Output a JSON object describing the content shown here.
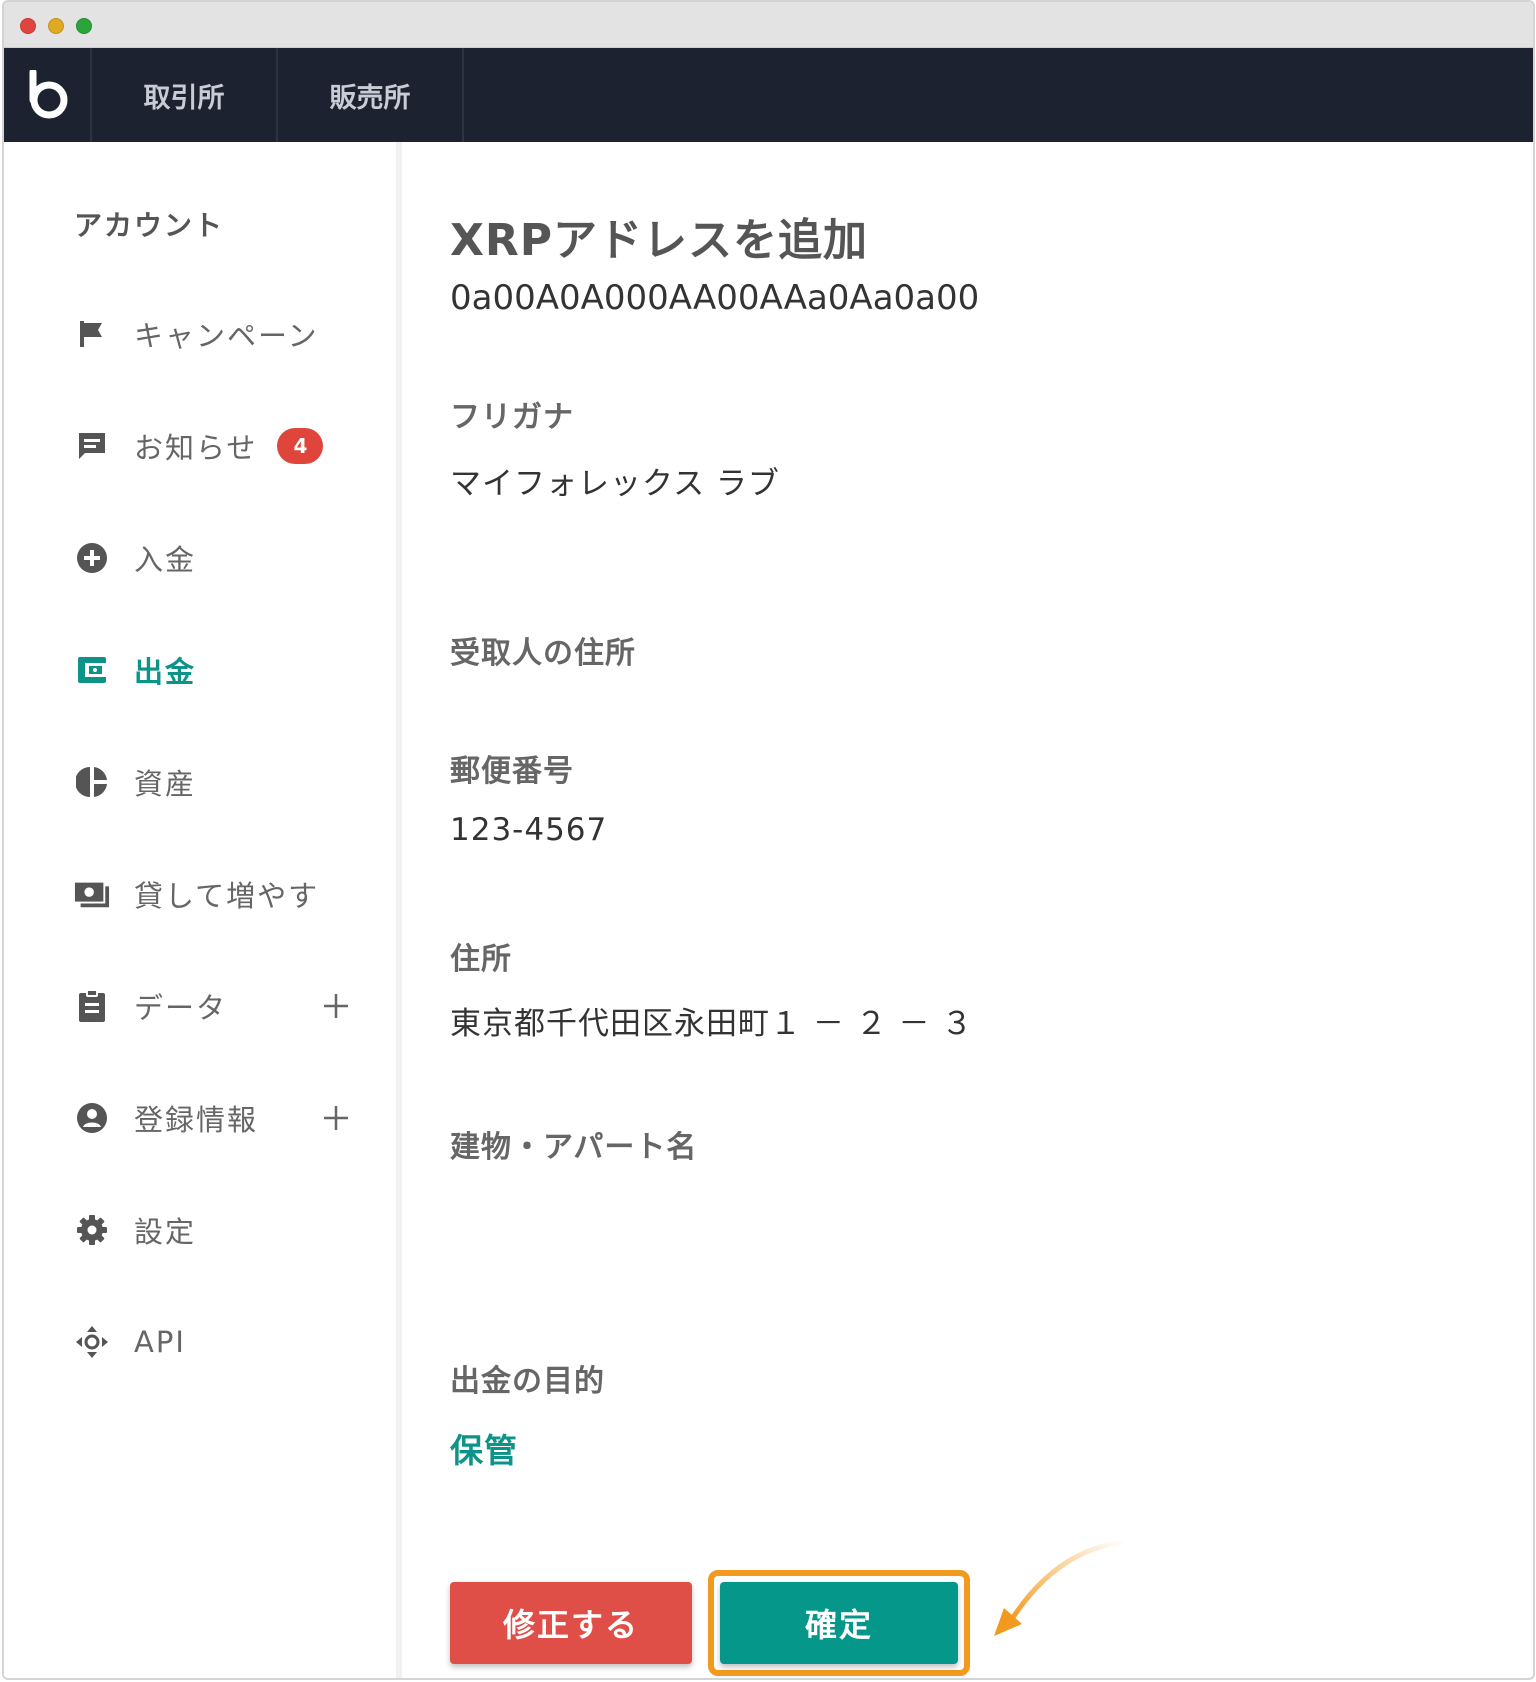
{
  "nav": {
    "logo": "b",
    "tabs": [
      "取引所",
      "販売所"
    ]
  },
  "sidebar": {
    "title": "アカウント",
    "items": [
      {
        "label": "キャンペーン",
        "icon": "flag-icon"
      },
      {
        "label": "お知らせ",
        "icon": "message-icon",
        "badge": "4"
      },
      {
        "label": "入金",
        "icon": "plus-circle-icon"
      },
      {
        "label": "出金",
        "icon": "wallet-icon",
        "active": true
      },
      {
        "label": "資産",
        "icon": "pie-chart-icon"
      },
      {
        "label": "貸して増やす",
        "icon": "money-icon"
      },
      {
        "label": "データ",
        "icon": "clipboard-icon",
        "expand": "+"
      },
      {
        "label": "登録情報",
        "icon": "account-icon",
        "expand": "+"
      },
      {
        "label": "設定",
        "icon": "gear-icon"
      },
      {
        "label": "API",
        "icon": "api-icon"
      }
    ]
  },
  "main": {
    "title": "XRPアドレスを追加",
    "address": "0a00A0A000AA00AAa0Aa0a00",
    "furigana_label": "フリガナ",
    "furigana_value": "マイフォレックス ラブ",
    "recipient_address_label": "受取人の住所",
    "postal_label": "郵便番号",
    "postal_value": "123-4567",
    "address_label": "住所",
    "address_value": "東京都千代田区永田町１ － ２ － ３",
    "building_label": "建物・アパート名",
    "building_value": "",
    "purpose_label": "出金の目的",
    "purpose_value": "保管"
  },
  "buttons": {
    "edit_label": "修正する",
    "confirm_label": "確定"
  },
  "colors": {
    "navbar": "#1c2230",
    "accent": "#0d9488",
    "edit_button": "#df4f48",
    "confirm_button": "#05988a",
    "highlight": "#f29a1f",
    "badge": "#e0453c"
  }
}
